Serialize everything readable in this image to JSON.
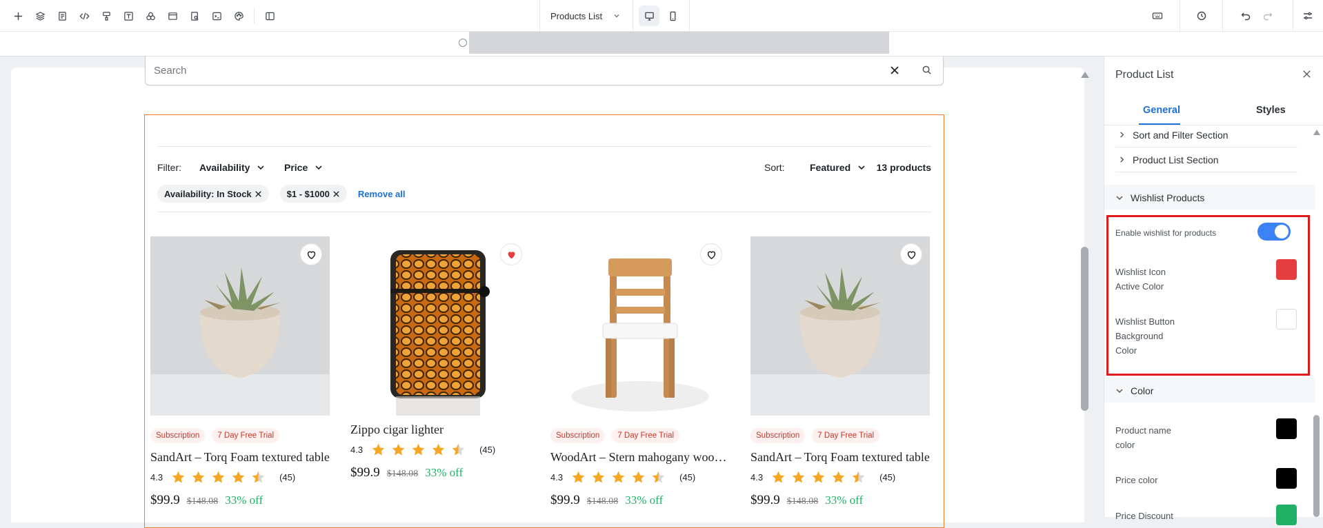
{
  "toolbar": {
    "page_selector": "Products List"
  },
  "search": {
    "placeholder": "Search"
  },
  "filters": {
    "filter_label": "Filter:",
    "availability": "Availability",
    "price": "Price",
    "sort_label": "Sort:",
    "sort_value": "Featured",
    "count": "13 products",
    "chips": [
      "Availability: In Stock",
      "$1 - $1000"
    ],
    "remove_all": "Remove all"
  },
  "products": [
    {
      "name": "SandArt – Torq Foam textured table",
      "badges": [
        "Subscription",
        "7 Day Free Trial"
      ],
      "rating": "4.3",
      "reviews": "(45)",
      "price": "$99.9",
      "old_price": "$148.08",
      "discount": "33% off",
      "wishlisted": false,
      "image": "succulent-pot"
    },
    {
      "name": "Zippo cigar lighter",
      "badges": [],
      "rating": "4.3",
      "reviews": "(45)",
      "price": "$99.9",
      "old_price": "$148.08",
      "discount": "33% off",
      "wishlisted": true,
      "image": "lighter"
    },
    {
      "name": "WoodArt – Stern mahogany wooden chair",
      "badges": [
        "Subscription",
        "7 Day Free Trial"
      ],
      "rating": "4.3",
      "reviews": "(45)",
      "price": "$99.9",
      "old_price": "$148.08",
      "discount": "33% off",
      "wishlisted": false,
      "image": "chair"
    },
    {
      "name": "SandArt – Torq Foam textured table",
      "badges": [
        "Subscription",
        "7 Day Free Trial"
      ],
      "rating": "4.3",
      "reviews": "(45)",
      "price": "$99.9",
      "old_price": "$148.08",
      "discount": "33% off",
      "wishlisted": false,
      "image": "succulent-pot"
    }
  ],
  "panel": {
    "title": "Product List",
    "tab_general": "General",
    "tab_styles": "Styles",
    "sort_filter_section": "Sort and Filter Section",
    "product_list_section": "Product List Section",
    "wishlist_group": "Wishlist Products",
    "enable_wishlist": "Enable wishlist for products",
    "wishlist_enabled": true,
    "wishlist_icon_active_color": "Wishlist Icon\nActive Color",
    "wishlist_icon_active_color_value": "#e53e3e",
    "wishlist_button_bg_color": "Wishlist Button\nBackground\nColor",
    "wishlist_button_bg_color_value": "#ffffff",
    "color_group": "Color",
    "product_name_color": "Product name\ncolor",
    "product_name_color_value": "#000000",
    "price_color": "Price color",
    "price_color_value": "#000000",
    "price_discount": "Price Discount",
    "price_discount_value": "#22b067"
  },
  "colors": {
    "accent": "#1f6fd8",
    "outline": "#f07e2c",
    "highlight": "#e01b1b",
    "star": "#f5a623",
    "heart_active": "#e53e3e",
    "discount": "#22b067"
  }
}
